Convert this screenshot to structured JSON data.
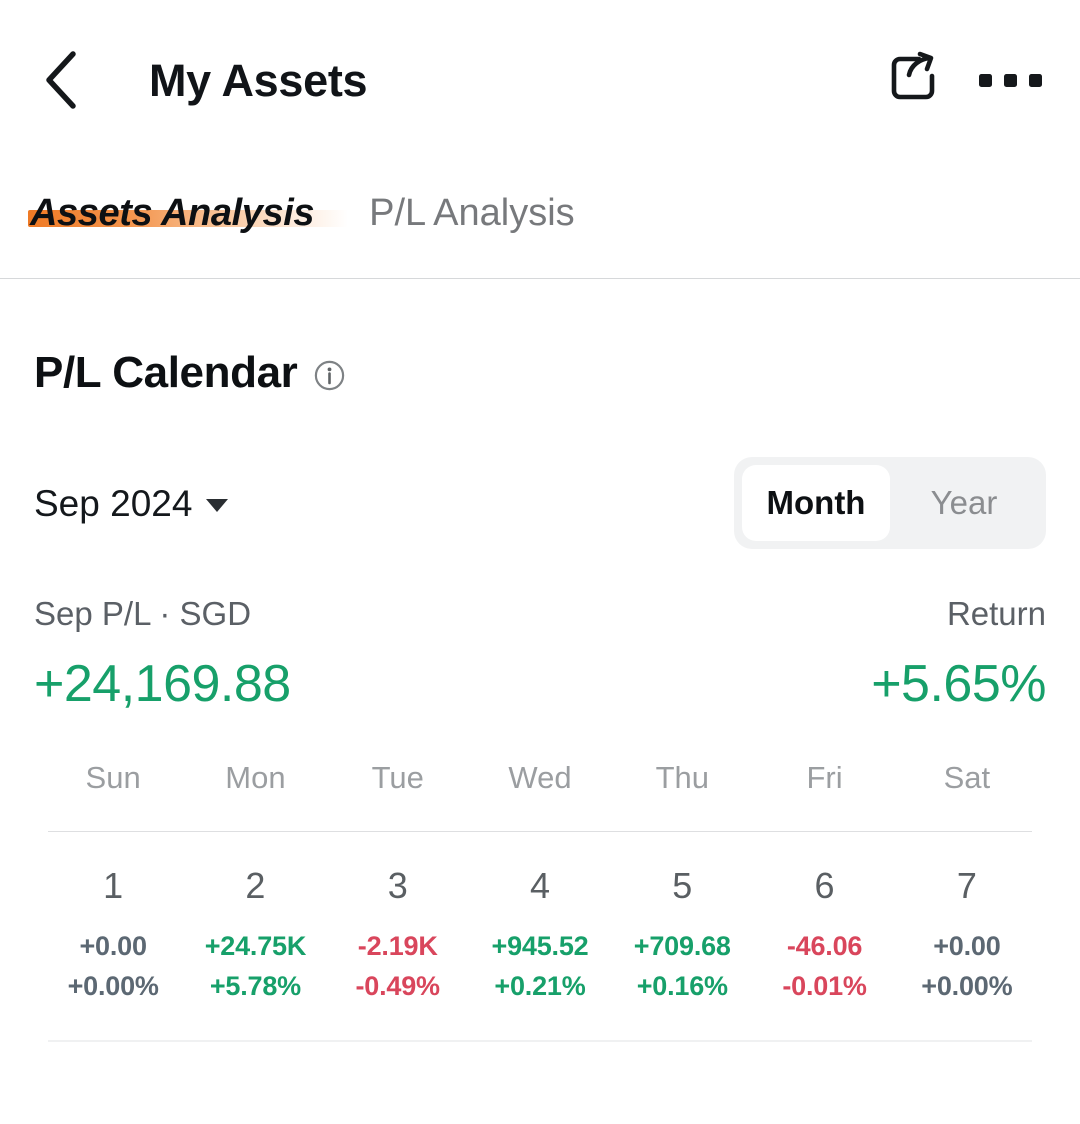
{
  "header": {
    "title": "My Assets",
    "back_icon": "chevron-left-icon",
    "share_icon": "share-icon",
    "more_icon": "more-horizontal-icon"
  },
  "tabs": [
    {
      "label": "Assets Analysis",
      "active": true
    },
    {
      "label": "P/L Analysis",
      "active": false
    }
  ],
  "calendar": {
    "title": "P/L Calendar",
    "info_icon": "info-circle-icon",
    "month_selector": "Sep 2024",
    "caret_icon": "chevron-down-icon",
    "range_options": [
      {
        "label": "Month",
        "active": true
      },
      {
        "label": "Year",
        "active": false
      }
    ],
    "summary": {
      "pl_label": "Sep P/L · SGD",
      "pl_value": "+24,169.88",
      "pl_state": "pos",
      "return_label": "Return",
      "return_value": "+5.65%",
      "return_state": "pos"
    },
    "weekdays": [
      "Sun",
      "Mon",
      "Tue",
      "Wed",
      "Thu",
      "Fri",
      "Sat"
    ],
    "weeks": [
      [
        {
          "day": "1",
          "amount": "+0.00",
          "percent": "+0.00%",
          "state": "zero"
        },
        {
          "day": "2",
          "amount": "+24.75K",
          "percent": "+5.78%",
          "state": "pos"
        },
        {
          "day": "3",
          "amount": "-2.19K",
          "percent": "-0.49%",
          "state": "neg"
        },
        {
          "day": "4",
          "amount": "+945.52",
          "percent": "+0.21%",
          "state": "pos"
        },
        {
          "day": "5",
          "amount": "+709.68",
          "percent": "+0.16%",
          "state": "pos"
        },
        {
          "day": "6",
          "amount": "-46.06",
          "percent": "-0.01%",
          "state": "neg"
        },
        {
          "day": "7",
          "amount": "+0.00",
          "percent": "+0.00%",
          "state": "zero"
        }
      ]
    ]
  },
  "colors": {
    "positive": "#17a06a",
    "negative": "#d9465c",
    "neutral": "#5c6873",
    "accent": "#ef7a25",
    "text_primary": "#0d1013",
    "text_muted": "#77797c"
  }
}
